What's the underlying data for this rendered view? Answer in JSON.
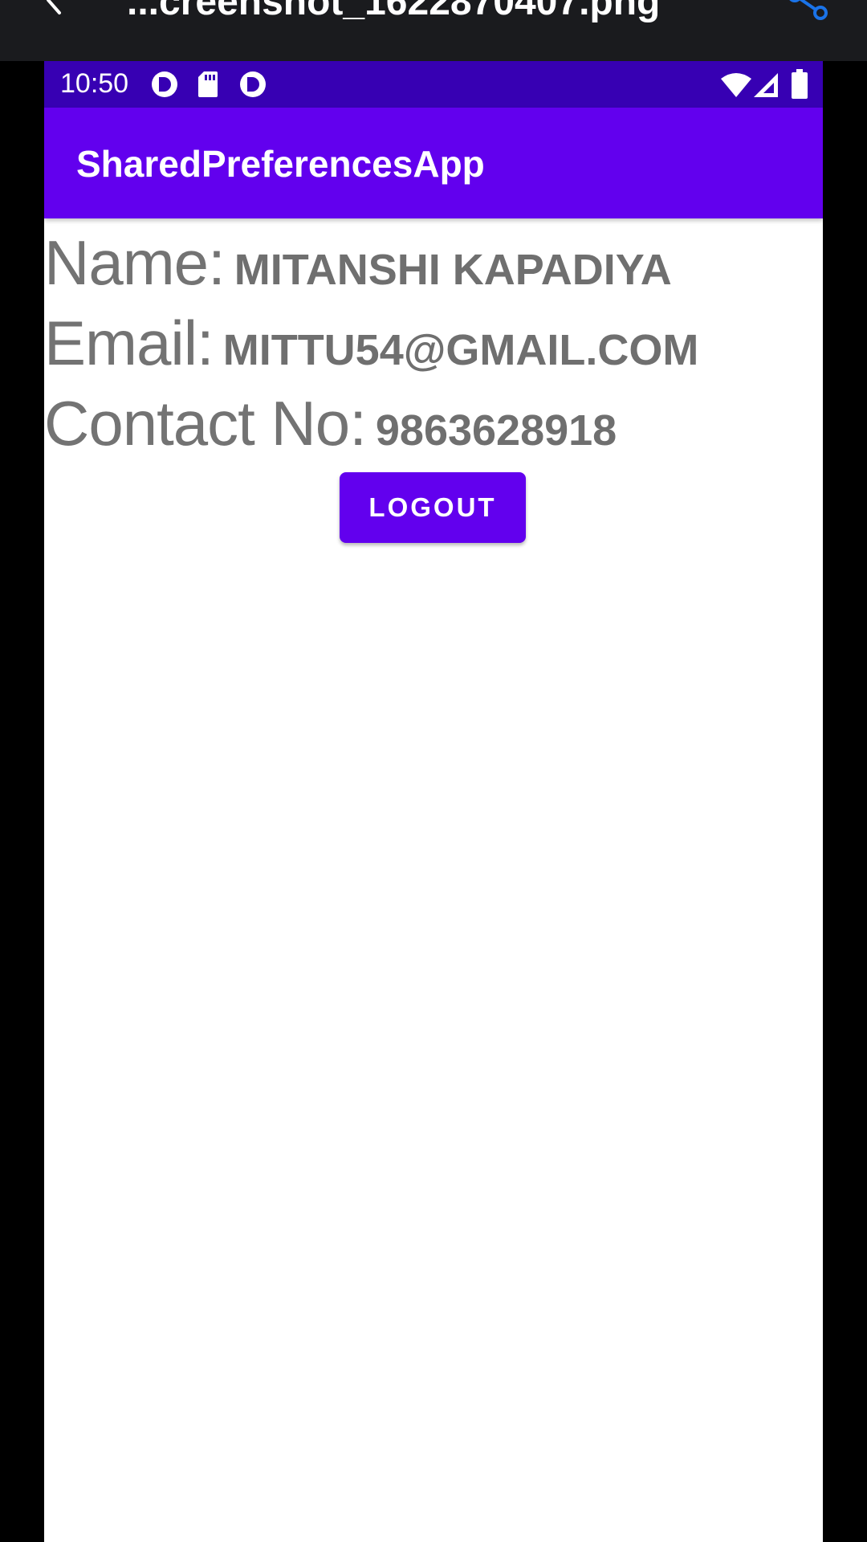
{
  "viewer": {
    "title": "...creenshot_1622870407.png",
    "back_icon": "chevron-left-icon",
    "share_icon": "share-icon",
    "share_color": "#1a73e8"
  },
  "status_bar": {
    "time": "10:50",
    "left_icons": [
      "app-notification-icon",
      "sd-card-icon",
      "app-notification-icon"
    ],
    "right_icons": [
      "wifi-icon",
      "cell-signal-icon",
      "battery-icon"
    ],
    "color": "#3700b3"
  },
  "app_bar": {
    "title": "SharedPreferencesApp",
    "color": "#6200ee"
  },
  "profile": {
    "name_label": "Name:",
    "name_value": "MITANSHI KAPADIYA",
    "email_label": "Email:",
    "email_value": "MITTU54@GMAIL.COM",
    "contact_label": "Contact No:",
    "contact_value": "9863628918"
  },
  "actions": {
    "logout_label": "LOGOUT",
    "button_color": "#6200ee"
  }
}
